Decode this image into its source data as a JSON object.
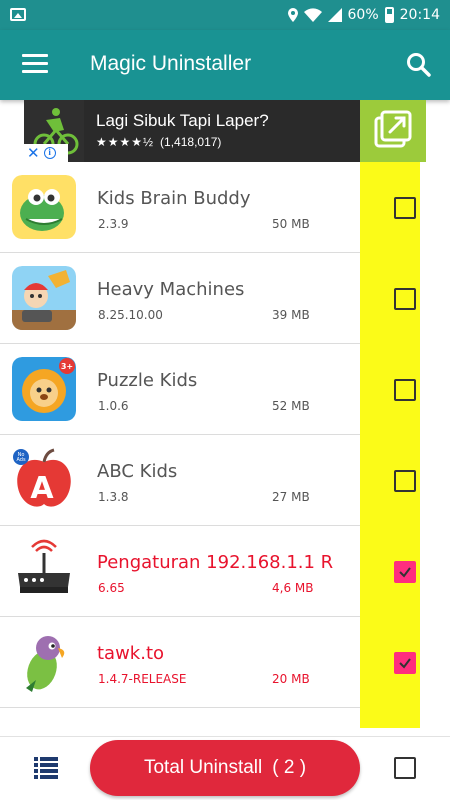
{
  "status_bar": {
    "battery": "60%",
    "time": "20:14"
  },
  "app_bar": {
    "title": "Magic Uninstaller",
    "menu_icon": "hamburger-menu-icon",
    "search_icon": "search-icon"
  },
  "ad": {
    "title": "Lagi Sibuk Tapi Laper?",
    "stars": "★★★★½",
    "reviews": "(1,418,017)",
    "open_icon": "open-external-icon"
  },
  "apps": [
    {
      "name": "Kids Brain Buddy",
      "version": "2.3.9",
      "size": "50 MB",
      "checked": false
    },
    {
      "name": "Heavy Machines",
      "version": "8.25.10.00",
      "size": "39 MB",
      "checked": false
    },
    {
      "name": "Puzzle Kids",
      "version": "1.0.6",
      "size": "52 MB",
      "checked": false
    },
    {
      "name": "ABC Kids",
      "version": "1.3.8",
      "size": "27 MB",
      "checked": false
    },
    {
      "name": "Pengaturan 192.168.1.1 R",
      "version": "6.65",
      "size": "4,6 MB",
      "checked": true
    },
    {
      "name": "tawk.to",
      "version": "1.4.7-RELEASE",
      "size": "20 MB",
      "checked": true
    }
  ],
  "bottom_bar": {
    "uninstall_label": "Total Uninstall",
    "uninstall_count": "( 2 )",
    "list_icon": "list-view-icon"
  },
  "colors": {
    "primary": "#199393",
    "status_bar": "#1f8f8f",
    "accent_yellow": "#fbfb18",
    "selected_text": "#e8132d",
    "check": "#ff2e7e",
    "uninstall_button": "#e0283c",
    "ad_open": "#9ccb3b"
  }
}
